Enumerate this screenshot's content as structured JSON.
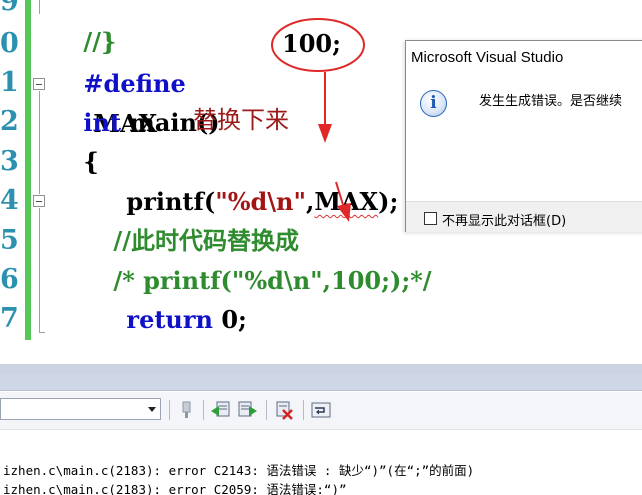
{
  "editor": {
    "line_numbers": [
      "9",
      "0",
      "1",
      "2",
      "3",
      "4",
      "5",
      "6",
      "7"
    ],
    "lines": {
      "l0": "//}",
      "l1_kw": "#define",
      "l1_name": "MAX",
      "l1_value": "100;",
      "l2_kw": "int",
      "l2_rest": " main()",
      "l3": "{",
      "l4_fn": "printf(",
      "l4_str": "\"%d\\n\"",
      "l4_comma": ",",
      "l4_macro": "MAX",
      "l4_end": ");",
      "l5": "//此时代码替换成",
      "l6": "/* printf(\"%d\\n\",100;);*/",
      "l7_kw": "return",
      "l7_rest": " 0;",
      "l8": "}"
    },
    "annotation": "替换下来"
  },
  "dialog": {
    "title": "Microsoft Visual Studio",
    "message": "发生生成错误。是否继续",
    "icon": "info-icon",
    "checkbox_label": "不再显示此对话框(D)"
  },
  "output": {
    "lines": [
      "izhen.c\\main.c(2183): error C2143: 语法错误 : 缺少“)”(在“;”的前面)",
      "izhen.c\\main.c(2183): error C2059: 语法错误:“)”"
    ]
  },
  "colors": {
    "gutter_bar": "#56c857",
    "annotation_red": "#e02828",
    "keyword_blue": "#1010c8",
    "comment_green": "#2e8b2e",
    "string_red": "#a31515"
  }
}
